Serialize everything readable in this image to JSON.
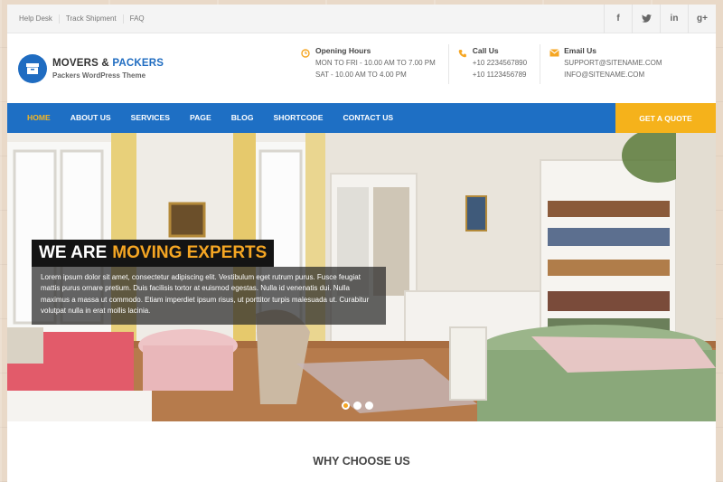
{
  "topbar": {
    "links": [
      "Help Desk",
      "Track Shipment",
      "FAQ"
    ],
    "social": [
      {
        "icon": "facebook-icon",
        "glyph": "f"
      },
      {
        "icon": "twitter-icon",
        "glyph": "t"
      },
      {
        "icon": "linkedin-icon",
        "glyph": "in"
      },
      {
        "icon": "google-plus-icon",
        "glyph": "g+"
      }
    ]
  },
  "logo": {
    "title_main": "MOVERS & ",
    "title_accent": "PACKERS",
    "subtitle": "Packers WordPress Theme"
  },
  "info": {
    "hours": {
      "title": "Opening Hours",
      "lines": [
        "MON TO FRI - 10.00 AM TO 7.00 PM",
        "SAT - 10.00 AM TO 4.00 PM"
      ]
    },
    "call": {
      "title": "Call Us",
      "lines": [
        "+10 2234567890",
        "+10 1123456789"
      ]
    },
    "email": {
      "title": "Email Us",
      "lines": [
        "SUPPORT@SITENAME.COM",
        "INFO@SITENAME.COM"
      ]
    }
  },
  "nav": {
    "items": [
      "HOME",
      "ABOUT US",
      "SERVICES",
      "PAGE",
      "BLOG",
      "SHORTCODE",
      "CONTACT US"
    ],
    "active": "HOME",
    "cta": "GET A QUOTE"
  },
  "hero": {
    "title_main": "WE ARE",
    "title_highlight": "MOVING EXPERTS",
    "text": "Lorem ipsum dolor sit amet, consectetur adipiscing elit. Vestibulum eget rutrum purus. Fusce feugiat mattis purus ornare pretium. Duis facilisis tortor at euismod egestas. Nulla id venenatis dui. Nulla maximus a massa ut commodo. Etiam imperdiet ipsum risus, ut porttitor turpis malesuada ut. Curabitur volutpat nulla in erat mollis lacinia.",
    "slides_total": 3,
    "slide_active": 1
  },
  "section": {
    "title": "WHY CHOOSE US"
  },
  "colors": {
    "primary": "#1e6fc4",
    "accent": "#f5a623",
    "dark": "#141414"
  }
}
